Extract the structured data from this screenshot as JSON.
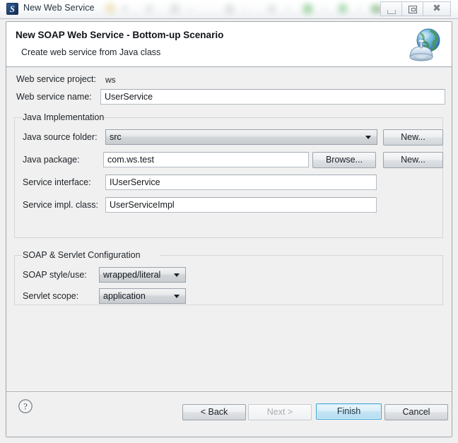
{
  "window": {
    "title": "New Web Service",
    "app_icon": "s-glyph-icon",
    "controls": {
      "minimize": "minimize-icon",
      "maximize": "maximize-icon",
      "close": "close-icon"
    }
  },
  "header": {
    "title": "New SOAP Web Service - Bottom-up Scenario",
    "subtitle": "Create web service from Java class",
    "icon": "globe-satellite-icon"
  },
  "form": {
    "project_label": "Web service project:",
    "project_value": "ws",
    "name_label": "Web service name:",
    "name_value": "UserService"
  },
  "java_group": {
    "legend": "Java Implementation",
    "source_folder": {
      "label": "Java source folder:",
      "value": "src",
      "button": "New..."
    },
    "package": {
      "label": "Java package:",
      "value": "com.ws.test",
      "browse_button": "Browse...",
      "new_button": "New..."
    },
    "interface": {
      "label": "Service interface:",
      "value": "IUserService"
    },
    "impl_class": {
      "label": "Service impl. class:",
      "value": "UserServiceImpl"
    }
  },
  "soap_group": {
    "legend": "SOAP & Servlet Configuration",
    "style_use": {
      "label": "SOAP style/use:",
      "value": "wrapped/literal"
    },
    "servlet_scope": {
      "label": "Servlet scope:",
      "value": "application"
    }
  },
  "footer": {
    "help_icon": "help-question-icon",
    "back": "< Back",
    "next": "Next >",
    "finish": "Finish",
    "cancel": "Cancel"
  },
  "colors": {
    "default_button_border": "#3ea6d6",
    "dialog_background": "#f0f0f0",
    "header_background": "#ffffff"
  }
}
